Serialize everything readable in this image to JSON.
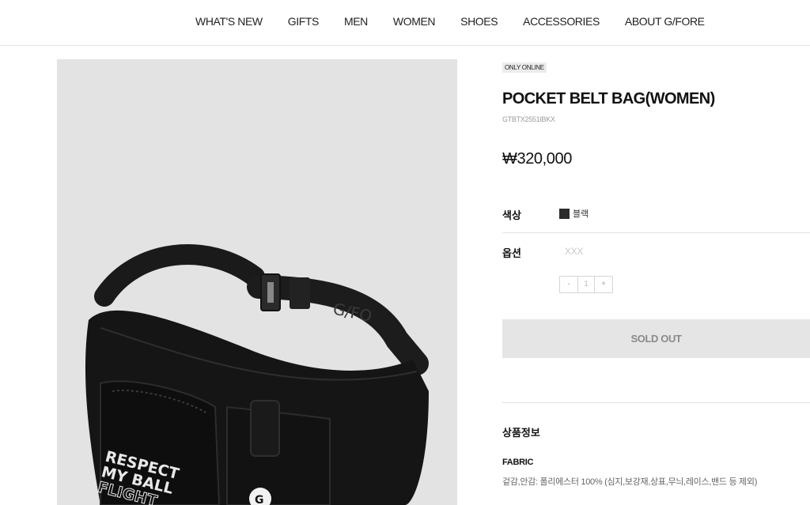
{
  "nav": {
    "items": [
      "WHAT'S NEW",
      "GIFTS",
      "MEN",
      "WOMEN",
      "SHOES",
      "ACCESSORIES",
      "ABOUT G/FORE"
    ]
  },
  "image": {
    "bag_text": [
      "RESPECT",
      "MY BALL",
      "FLIGHT"
    ],
    "strap_text": "G/FO",
    "logo_text": "G"
  },
  "product": {
    "badge": "ONLY ONLINE",
    "title": "POCKET BELT BAG(WOMEN)",
    "sku": "GTBTX2551IBKX",
    "price": "₩320,000",
    "color_label": "색상",
    "color_value": "블랙",
    "color_swatch": "#2b2b2b",
    "option_label": "옵션",
    "option_placeholder": "XXX",
    "qty_minus": "-",
    "qty_value": "1",
    "qty_plus": "+",
    "soldout_label": "SOLD OUT"
  },
  "details": {
    "section_title": "상품정보",
    "fabric_title": "FABRIC",
    "fabric_text": "겉감,안감: 폴리에스터 100% (심지,보강재,상표,무늬,레이스,밴드 등 제외)"
  }
}
